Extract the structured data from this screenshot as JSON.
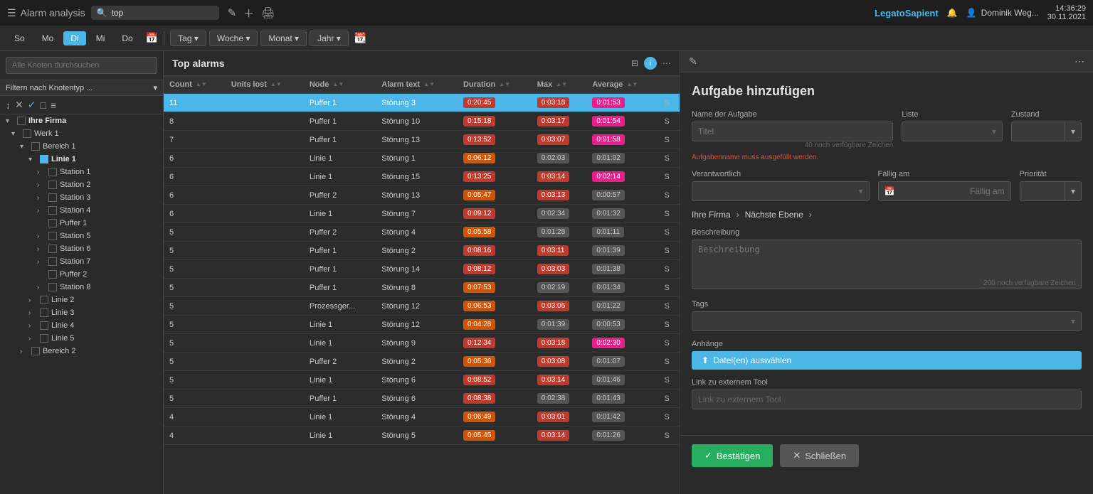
{
  "topNav": {
    "menuLabel": "Alarm analysis",
    "searchValue": "top",
    "searchPlaceholder": "top",
    "logoText": "Legato",
    "logoSpan": "Sapient",
    "userName": "Dominik Weg...",
    "timeText": "14:36:29",
    "dateText": "30.11.2021"
  },
  "dateBar": {
    "days": [
      "So",
      "Mo",
      "Di",
      "Mi",
      "Do"
    ],
    "activeDay": "Di",
    "buttons": [
      "Tag ▾",
      "Woche ▾",
      "Monat ▾",
      "Jahr ▾"
    ]
  },
  "sidebar": {
    "searchPlaceholder": "Alle Knoten durchsuchen",
    "filterLabel": "Filtern nach Knotentyp ...",
    "tree": [
      {
        "indent": 0,
        "expand": "",
        "checked": false,
        "label": "Ihre Firma",
        "type": "company"
      },
      {
        "indent": 1,
        "expand": "",
        "checked": false,
        "label": "Werk 1",
        "type": "werk"
      },
      {
        "indent": 2,
        "expand": "▾",
        "checked": false,
        "label": "Bereich 1",
        "type": "bereich"
      },
      {
        "indent": 3,
        "expand": "▾",
        "checked": true,
        "label": "Linie 1",
        "type": "linie"
      },
      {
        "indent": 4,
        "expand": "›",
        "checked": false,
        "label": "Station 1",
        "type": "station"
      },
      {
        "indent": 4,
        "expand": "›",
        "checked": false,
        "label": "Station 2",
        "type": "station"
      },
      {
        "indent": 4,
        "expand": "›",
        "checked": false,
        "label": "Station 3",
        "type": "station"
      },
      {
        "indent": 4,
        "expand": "›",
        "checked": false,
        "label": "Station 4",
        "type": "station"
      },
      {
        "indent": 4,
        "expand": "",
        "checked": false,
        "label": "Puffer 1",
        "type": "puffer"
      },
      {
        "indent": 4,
        "expand": "›",
        "checked": false,
        "label": "Station 5",
        "type": "station"
      },
      {
        "indent": 4,
        "expand": "›",
        "checked": false,
        "label": "Station 6",
        "type": "station"
      },
      {
        "indent": 4,
        "expand": "›",
        "checked": false,
        "label": "Station 7",
        "type": "station"
      },
      {
        "indent": 4,
        "expand": "",
        "checked": false,
        "label": "Puffer 2",
        "type": "puffer"
      },
      {
        "indent": 4,
        "expand": "›",
        "checked": false,
        "label": "Station 8",
        "type": "station"
      },
      {
        "indent": 3,
        "expand": "›",
        "checked": false,
        "label": "Linie 2",
        "type": "linie"
      },
      {
        "indent": 3,
        "expand": "›",
        "checked": false,
        "label": "Linie 3",
        "type": "linie"
      },
      {
        "indent": 3,
        "expand": "›",
        "checked": false,
        "label": "Linie 4",
        "type": "linie"
      },
      {
        "indent": 3,
        "expand": "›",
        "checked": false,
        "label": "Linie 5",
        "type": "linie"
      },
      {
        "indent": 2,
        "expand": "›",
        "checked": false,
        "label": "Bereich 2",
        "type": "bereich"
      }
    ]
  },
  "table": {
    "title": "Top alarms",
    "columns": [
      {
        "label": "Count",
        "sort": true
      },
      {
        "label": "Units lost",
        "sort": true
      },
      {
        "label": "Node",
        "sort": true
      },
      {
        "label": "Alarm text",
        "sort": true
      },
      {
        "label": "Duration",
        "sort": true
      },
      {
        "label": "Max",
        "sort": true
      },
      {
        "label": "Average",
        "sort": true
      },
      {
        "label": "",
        "sort": false
      }
    ],
    "rows": [
      {
        "count": "11",
        "units": "",
        "node": "Puffer 1",
        "text": "Störung 3",
        "duration": "0:20:45",
        "max": "0:03:18",
        "avg": "0:01:53",
        "s": "S",
        "highlighted": true,
        "durColor": "red",
        "maxColor": "red",
        "avgColor": "pink"
      },
      {
        "count": "8",
        "units": "",
        "node": "Puffer 1",
        "text": "Störung 10",
        "duration": "0:15:18",
        "max": "0:03:17",
        "avg": "0:01:54",
        "s": "S",
        "highlighted": false,
        "durColor": "red",
        "maxColor": "red",
        "avgColor": "pink"
      },
      {
        "count": "7",
        "units": "",
        "node": "Puffer 1",
        "text": "Störung 13",
        "duration": "0:13:52",
        "max": "0:03:07",
        "avg": "0:01:58",
        "s": "S",
        "highlighted": false,
        "durColor": "red",
        "maxColor": "red",
        "avgColor": "pink"
      },
      {
        "count": "6",
        "units": "",
        "node": "Linie 1",
        "text": "Störung 1",
        "duration": "0:06:12",
        "max": "0:02:03",
        "avg": "0:01:02",
        "s": "S",
        "highlighted": false,
        "durColor": "orange",
        "maxColor": "gray",
        "avgColor": "gray"
      },
      {
        "count": "6",
        "units": "",
        "node": "Linie 1",
        "text": "Störung 15",
        "duration": "0:13:25",
        "max": "0:03:14",
        "avg": "0:02:14",
        "s": "S",
        "highlighted": false,
        "durColor": "red",
        "maxColor": "red",
        "avgColor": "pink"
      },
      {
        "count": "6",
        "units": "",
        "node": "Puffer 2",
        "text": "Störung 13",
        "duration": "0:05:47",
        "max": "0:03:13",
        "avg": "0:00:57",
        "s": "S",
        "highlighted": false,
        "durColor": "orange",
        "maxColor": "red",
        "avgColor": "gray"
      },
      {
        "count": "6",
        "units": "",
        "node": "Linie 1",
        "text": "Störung 7",
        "duration": "0:09:12",
        "max": "0:02:34",
        "avg": "0:01:32",
        "s": "S",
        "highlighted": false,
        "durColor": "red",
        "maxColor": "gray",
        "avgColor": "gray"
      },
      {
        "count": "5",
        "units": "",
        "node": "Puffer 2",
        "text": "Störung 4",
        "duration": "0:05:58",
        "max": "0:01:28",
        "avg": "0:01:11",
        "s": "S",
        "highlighted": false,
        "durColor": "orange",
        "maxColor": "gray",
        "avgColor": "gray"
      },
      {
        "count": "5",
        "units": "",
        "node": "Puffer 1",
        "text": "Störung 2",
        "duration": "0:08:16",
        "max": "0:03:11",
        "avg": "0:01:39",
        "s": "S",
        "highlighted": false,
        "durColor": "red",
        "maxColor": "red",
        "avgColor": "gray"
      },
      {
        "count": "5",
        "units": "",
        "node": "Puffer 1",
        "text": "Störung 14",
        "duration": "0:08:12",
        "max": "0:03:03",
        "avg": "0:01:38",
        "s": "S",
        "highlighted": false,
        "durColor": "red",
        "maxColor": "red",
        "avgColor": "gray"
      },
      {
        "count": "5",
        "units": "",
        "node": "Puffer 1",
        "text": "Störung 8",
        "duration": "0:07:53",
        "max": "0:02:19",
        "avg": "0:01:34",
        "s": "S",
        "highlighted": false,
        "durColor": "orange",
        "maxColor": "gray",
        "avgColor": "gray"
      },
      {
        "count": "5",
        "units": "",
        "node": "Prozessger...",
        "text": "Störung 12",
        "duration": "0:06:53",
        "max": "0:03:06",
        "avg": "0:01:22",
        "s": "S",
        "highlighted": false,
        "durColor": "orange",
        "maxColor": "red",
        "avgColor": "gray"
      },
      {
        "count": "5",
        "units": "",
        "node": "Linie 1",
        "text": "Störung 12",
        "duration": "0:04:28",
        "max": "0:01:39",
        "avg": "0:00:53",
        "s": "S",
        "highlighted": false,
        "durColor": "orange",
        "maxColor": "gray",
        "avgColor": "gray"
      },
      {
        "count": "5",
        "units": "",
        "node": "Linie 1",
        "text": "Störung 9",
        "duration": "0:12:34",
        "max": "0:03:18",
        "avg": "0:02:30",
        "s": "S",
        "highlighted": false,
        "durColor": "red",
        "maxColor": "red",
        "avgColor": "pink"
      },
      {
        "count": "5",
        "units": "",
        "node": "Puffer 2",
        "text": "Störung 2",
        "duration": "0:05:36",
        "max": "0:03:08",
        "avg": "0:01:07",
        "s": "S",
        "highlighted": false,
        "durColor": "orange",
        "maxColor": "red",
        "avgColor": "gray"
      },
      {
        "count": "5",
        "units": "",
        "node": "Linie 1",
        "text": "Störung 6",
        "duration": "0:08:52",
        "max": "0:03:14",
        "avg": "0:01:46",
        "s": "S",
        "highlighted": false,
        "durColor": "red",
        "maxColor": "red",
        "avgColor": "gray"
      },
      {
        "count": "5",
        "units": "",
        "node": "Puffer 1",
        "text": "Störung 6",
        "duration": "0:08:38",
        "max": "0:02:38",
        "avg": "0:01:43",
        "s": "S",
        "highlighted": false,
        "durColor": "red",
        "maxColor": "gray",
        "avgColor": "gray"
      },
      {
        "count": "4",
        "units": "",
        "node": "Linie 1",
        "text": "Störung 4",
        "duration": "0:06:49",
        "max": "0:03:01",
        "avg": "0:01:42",
        "s": "S",
        "highlighted": false,
        "durColor": "orange",
        "maxColor": "red",
        "avgColor": "gray"
      },
      {
        "count": "4",
        "units": "",
        "node": "Linie 1",
        "text": "Störung 5",
        "duration": "0:05:45",
        "max": "0:03:14",
        "avg": "0:01:26",
        "s": "S",
        "highlighted": false,
        "durColor": "orange",
        "maxColor": "red",
        "avgColor": "gray"
      }
    ]
  },
  "rightPanel": {
    "title": "Aufgabe hinzufügen",
    "nameLabel": "Name der Aufgabe",
    "namePlaceholder": "Titel",
    "nameChars": "40 noch verfügbare Zeichen",
    "nameError": "Aufgabenname muss ausgefüllt werden.",
    "listeLabel": "Liste",
    "listePlaceholder": "",
    "zustandLabel": "Zustand",
    "zustandPlaceholder": "",
    "verantwortlichLabel": "Verantwortlich",
    "falligLabel": "Fällig am",
    "falligPlaceholder": "Fällig am",
    "prioritaetLabel": "Priorität",
    "breadcrumb1": "Ihre Firma",
    "breadcrumb2": "Nächste Ebene",
    "beschreibungLabel": "Beschreibung",
    "beschreibungPlaceholder": "Beschreibung",
    "beschreibungChars": "200 noch verfügbare Zeichen",
    "tagsLabel": "Tags",
    "anhaengeLabel": "Anhänge",
    "uploadLabel": "Datei(en) auswählen",
    "linkLabel": "Link zu externem Tool",
    "linkPlaceholder": "Link zu externem Tool",
    "confirmLabel": "Bestätigen",
    "closeLabel": "Schließen"
  }
}
